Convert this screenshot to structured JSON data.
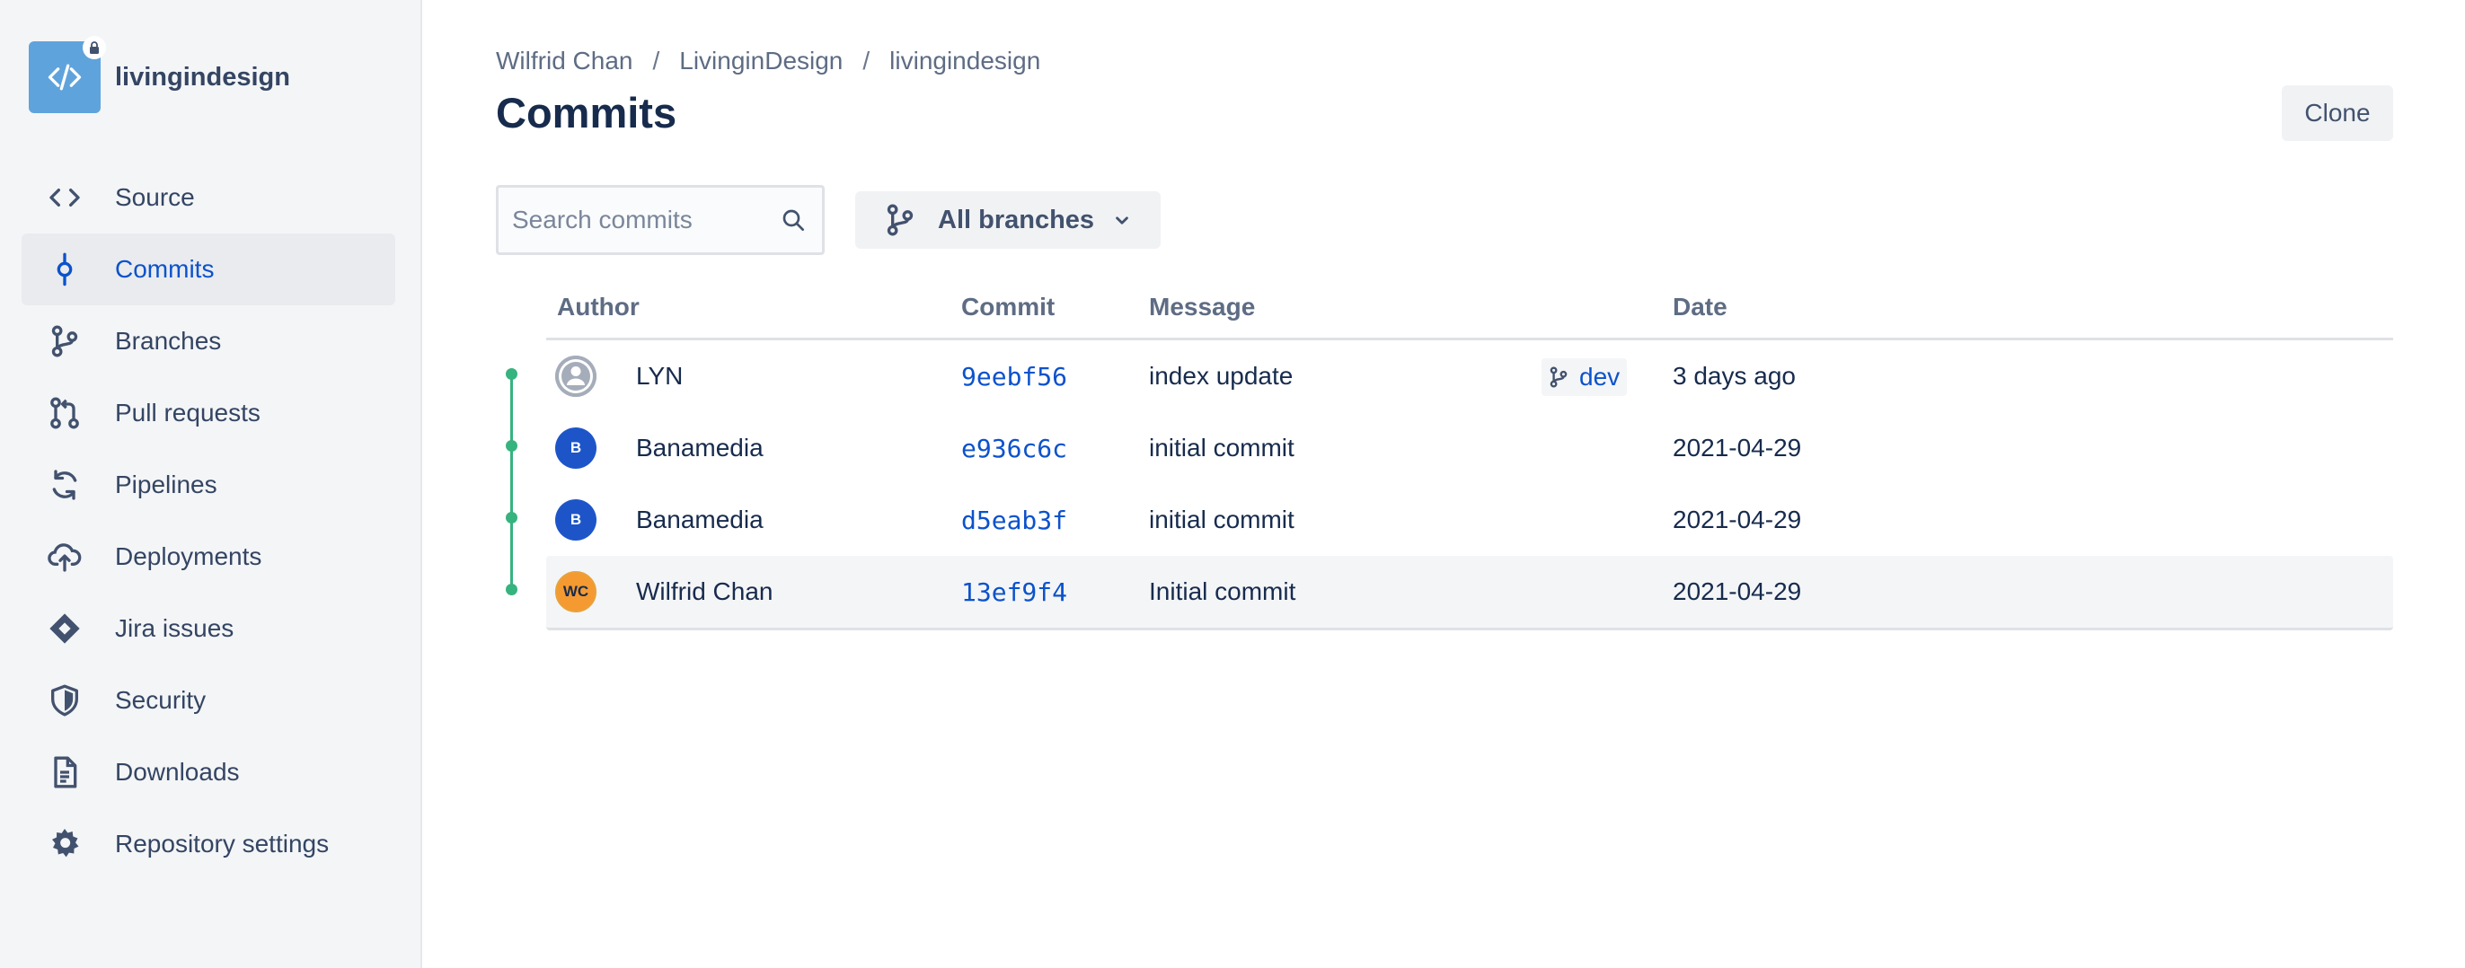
{
  "repo": {
    "name": "livingindesign"
  },
  "sidebar": {
    "items": [
      {
        "label": "Source",
        "icon": "code-icon"
      },
      {
        "label": "Commits",
        "icon": "commit-icon",
        "active": true
      },
      {
        "label": "Branches",
        "icon": "branch-icon"
      },
      {
        "label": "Pull requests",
        "icon": "pull-request-icon"
      },
      {
        "label": "Pipelines",
        "icon": "pipelines-icon"
      },
      {
        "label": "Deployments",
        "icon": "cloud-upload-icon"
      },
      {
        "label": "Jira issues",
        "icon": "jira-icon"
      },
      {
        "label": "Security",
        "icon": "shield-icon"
      },
      {
        "label": "Downloads",
        "icon": "document-icon"
      },
      {
        "label": "Repository settings",
        "icon": "gear-icon"
      }
    ]
  },
  "breadcrumb": [
    "Wilfrid Chan",
    "LivinginDesign",
    "livingindesign"
  ],
  "breadcrumb_sep": "/",
  "page": {
    "title": "Commits",
    "clone_label": "Clone"
  },
  "search": {
    "placeholder": "Search commits",
    "value": ""
  },
  "branch_filter": {
    "label": "All branches"
  },
  "table": {
    "columns": {
      "author": "Author",
      "commit": "Commit",
      "message": "Message",
      "date": "Date"
    },
    "rows": [
      {
        "author": "LYN",
        "avatar": "",
        "hash": "9eebf56",
        "message": "index update",
        "branch": "dev",
        "date": "3 days ago"
      },
      {
        "author": "Banamedia",
        "avatar": "B",
        "hash": "e936c6c",
        "message": "initial commit",
        "date": "2021-04-29"
      },
      {
        "author": "Banamedia",
        "avatar": "B",
        "hash": "d5eab3f",
        "message": "initial commit",
        "date": "2021-04-29"
      },
      {
        "author": "Wilfrid Chan",
        "avatar": "WC",
        "hash": "13ef9f4",
        "message": "Initial commit",
        "date": "2021-04-29"
      }
    ]
  },
  "colors": {
    "accent": "#0c52cc",
    "graph": "#36b37e",
    "sidebar_bg": "#f4f5f7"
  }
}
